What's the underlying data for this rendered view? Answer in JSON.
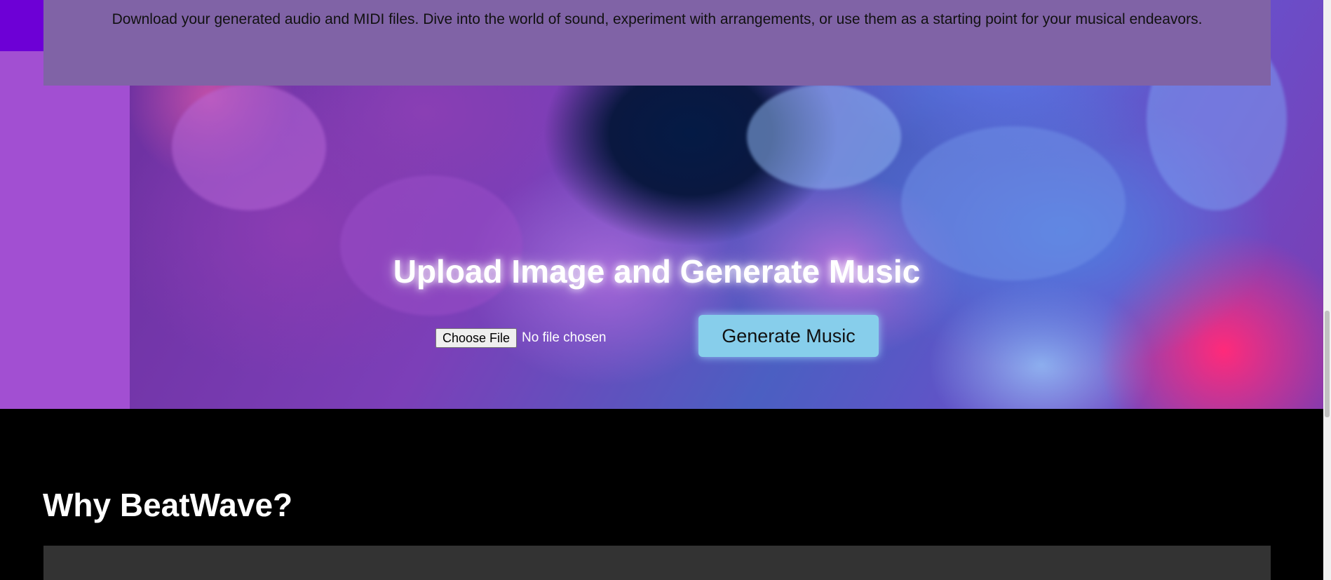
{
  "info_box": {
    "text": "Download your generated audio and MIDI files. Dive into the world of sound, experiment with arrangements, or use them as a starting point for your musical endeavors."
  },
  "hero": {
    "title": "Upload Image and Generate Music",
    "file_button_label": "Choose File",
    "file_status": "No file chosen",
    "generate_label": "Generate Music"
  },
  "why": {
    "title": "Why BeatWave?"
  },
  "colors": {
    "accent_purple": "#6d00d6",
    "side_band": "#a24fd2",
    "info_box_bg": "#8063a6",
    "generate_button": "#87ceeb",
    "dark_card": "#333333"
  }
}
